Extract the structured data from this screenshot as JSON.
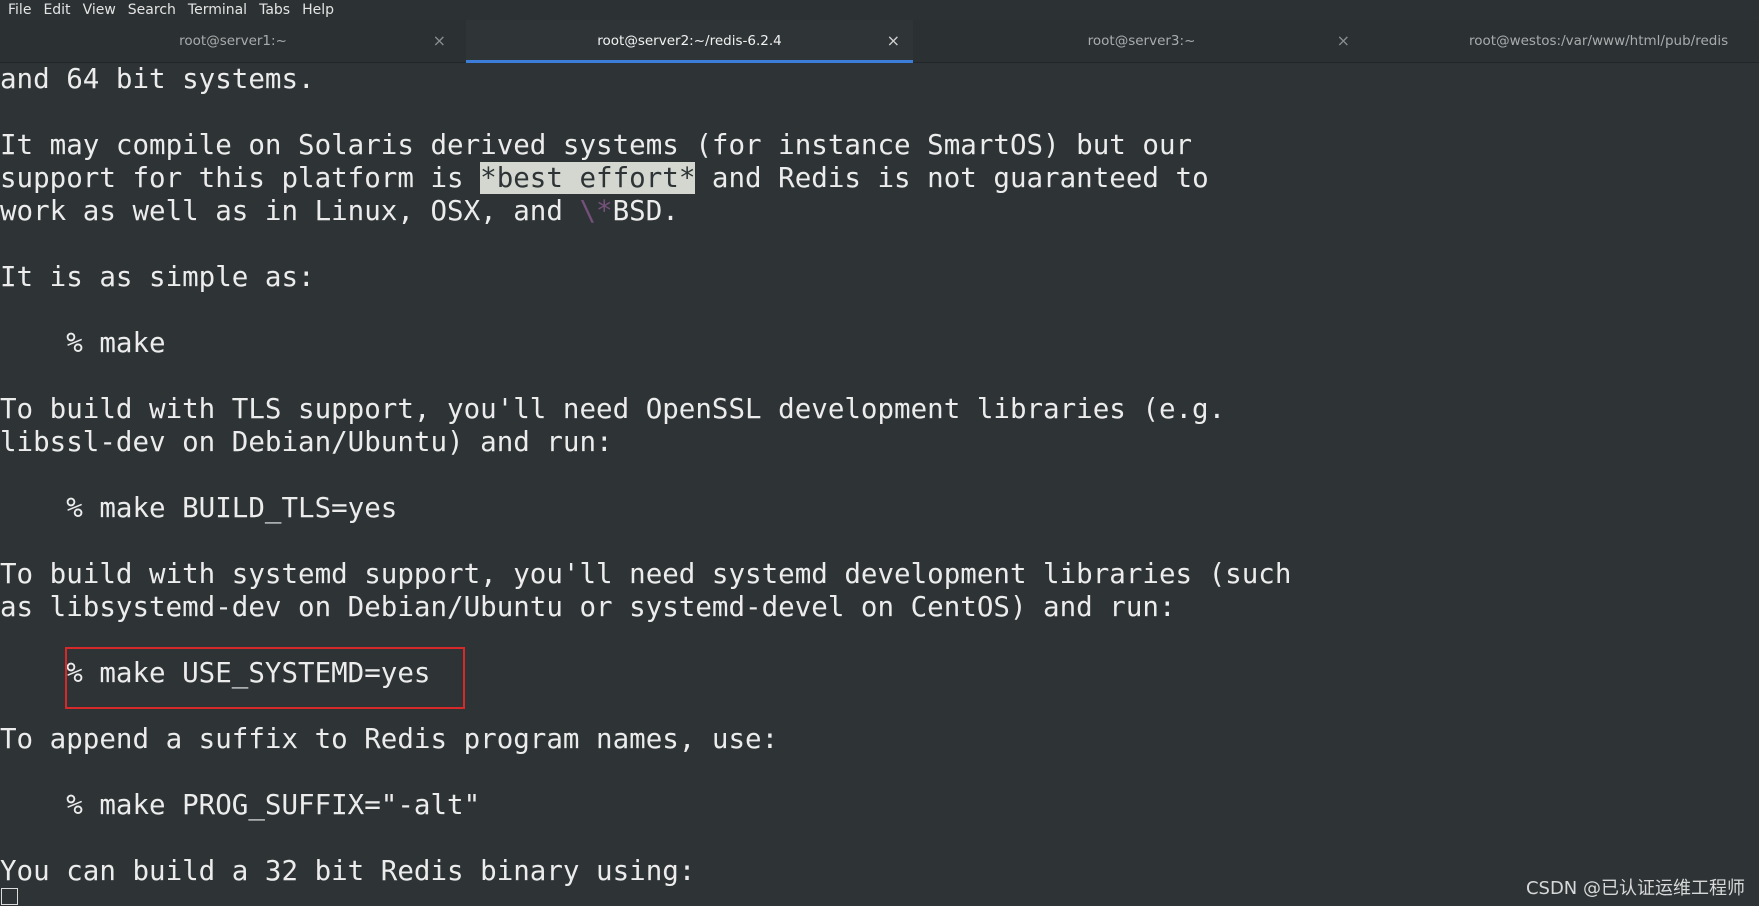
{
  "menu": [
    "File",
    "Edit",
    "View",
    "Search",
    "Terminal",
    "Tabs",
    "Help"
  ],
  "tabs": [
    {
      "label": "root@server1:~",
      "close": "×"
    },
    {
      "label": "root@server2:~/redis-6.2.4",
      "close": "×"
    },
    {
      "label": "root@server3:~",
      "close": "×"
    },
    {
      "label": "root@westos:/var/www/html/pub/redis"
    }
  ],
  "terminal": {
    "lines": [
      "and 64 bit systems.",
      "It may compile on Solaris derived systems (for instance SmartOS) but our",
      {
        "before": "support for this platform is ",
        "highlight": "*best effort*",
        "after": " and Redis is not guaranteed to"
      },
      {
        "before": "work as well as in Linux, OSX, and ",
        "dim": "\\*",
        "after": "BSD."
      },
      "It is as simple as:",
      "    % make",
      "To build with TLS support, you'll need OpenSSL development libraries (e.g.",
      "libssl-dev on Debian/Ubuntu) and run:",
      "    % make BUILD_TLS=yes",
      "To build with systemd support, you'll need systemd development libraries (such",
      "as libsystemd-dev on Debian/Ubuntu or systemd-devel on CentOS) and run:",
      "    % make USE_SYSTEMD=yes",
      "To append a suffix to Redis program names, use:",
      "    % make PROG_SUFFIX=\"-alt\"",
      "You can build a 32 bit Redis binary using:"
    ]
  },
  "watermark": "CSDN @已认证运维工程师",
  "colors": {
    "background": "#2e3436",
    "text": "#ececec",
    "highlight_bg": "#d3d7cf",
    "active_tab_indicator": "#3b7dd8",
    "annotation_box": "#d62a2a"
  }
}
